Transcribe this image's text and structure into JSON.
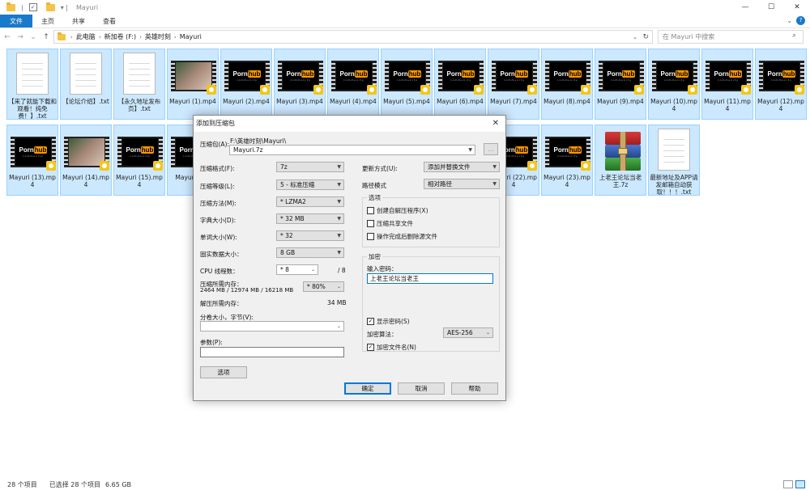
{
  "window": {
    "title": "Mayuri",
    "controls": {
      "minimize": "—",
      "maximize": "☐",
      "close": "✕"
    }
  },
  "ribbon": {
    "tabs": [
      "文件",
      "主页",
      "共享",
      "查看"
    ],
    "expand": "⌄",
    "help": "?"
  },
  "address": {
    "crumbs": [
      "此电脑",
      "新加卷 (F:)",
      "英雄时刻",
      "Mayuri"
    ],
    "search_placeholder": "在 Mayuri 中搜索"
  },
  "files": [
    {
      "name": "【来了就能下载和观看！纯免费！】.txt",
      "type": "txt"
    },
    {
      "name": "【论坛介绍】.txt",
      "type": "txt"
    },
    {
      "name": "【永久地址发布页】.txt",
      "type": "txt"
    },
    {
      "name": "Mayuri (1).mp4",
      "type": "photo"
    },
    {
      "name": "Mayuri (2).mp4",
      "type": "ph"
    },
    {
      "name": "Mayuri (3).mp4",
      "type": "ph"
    },
    {
      "name": "Mayuri (4).mp4",
      "type": "ph"
    },
    {
      "name": "Mayuri (5).mp4",
      "type": "ph"
    },
    {
      "name": "Mayuri (6).mp4",
      "type": "ph"
    },
    {
      "name": "Mayuri (7).mp4",
      "type": "ph"
    },
    {
      "name": "Mayuri (8).mp4",
      "type": "ph"
    },
    {
      "name": "Mayuri (9).mp4",
      "type": "ph"
    },
    {
      "name": "Mayuri (10).mp4",
      "type": "ph"
    },
    {
      "name": "Mayuri (11).mp4",
      "type": "ph"
    },
    {
      "name": "Mayuri (12).mp4",
      "type": "ph"
    },
    {
      "name": "Mayuri (13).mp4",
      "type": "ph"
    },
    {
      "name": "Mayuri (14).mp4",
      "type": "photo"
    },
    {
      "name": "Mayuri (15).mp4",
      "type": "ph"
    },
    {
      "name": "Mayuri (16)",
      "type": "ph"
    },
    {
      "name": "",
      "type": "ph"
    },
    {
      "name": "",
      "type": "ph"
    },
    {
      "name": "",
      "type": "ph"
    },
    {
      "name": "",
      "type": "ph"
    },
    {
      "name": "",
      "type": "ph"
    },
    {
      "name": "Mayuri (22).mp4",
      "type": "ph"
    },
    {
      "name": "Mayuri (23).mp4",
      "type": "ph"
    },
    {
      "name": "上老王论坛当老王.7z",
      "type": "rar"
    },
    {
      "name": "最新地址及APP请发邮箱自动获取！！！.txt",
      "type": "txt"
    }
  ],
  "thumb_logo": {
    "porn": "Porn",
    "hub": "hub",
    "sub": "community"
  },
  "status": {
    "count": "28 个项目",
    "selected": "已选择 28 个项目",
    "size": "6.65 GB"
  },
  "dialog": {
    "title": "添加到压缩包",
    "close": "✕",
    "archive_label": "压缩包(A):",
    "archive_path": "F:\\英雄时刻\\Mayuri\\",
    "archive_name": "Mayuri.7z",
    "browse": "...",
    "format_label": "压缩格式(F):",
    "format_value": "7z",
    "level_label": "压缩等级(L):",
    "level_value": "5 - 标准压缩",
    "method_label": "压缩方法(M):",
    "method_value": "* LZMA2",
    "dict_label": "字典大小(D):",
    "dict_value": "* 32 MB",
    "word_label": "单词大小(W):",
    "word_value": "* 32",
    "solid_label": "固实数据大小：",
    "solid_value": "8 GB",
    "threads_label": "CPU 线程数：",
    "threads_value": "* 8",
    "threads_max": "/ 8",
    "mem_label": "压缩所需内存：",
    "mem_detail": "2464 MB / 12974 MB / 16218 MB",
    "mem_pct": "* 80%",
    "decomp_label": "解压所需内存：",
    "decomp_value": "34 MB",
    "split_label": "分卷大小，字节(V):",
    "params_label": "参数(P):",
    "options_btn": "选项",
    "update_label": "更新方式(U):",
    "update_value": "添加并替换文件",
    "path_label": "路径模式",
    "path_value": "相对路径",
    "opts_title": "选项",
    "opt_sfx": "创建自解压程序(X)",
    "opt_shared": "压缩共享文件",
    "opt_delete": "操作完成后删除源文件",
    "enc_title": "加密",
    "pwd_label": "输入密码：",
    "pwd_value": "上老王论坛当老王",
    "show_pwd": "显示密码(S)",
    "enc_method_label": "加密算法：",
    "enc_method_value": "AES-256",
    "enc_names": "加密文件名(N)",
    "check_mark": "✓",
    "ok": "确定",
    "cancel": "取消",
    "help": "帮助"
  }
}
